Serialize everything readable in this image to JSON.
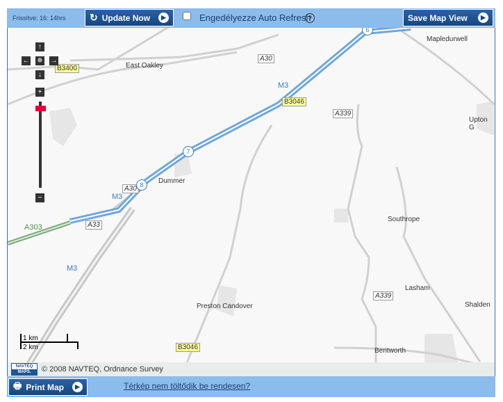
{
  "topbar": {
    "refreshed": "Frissítve: 16: 14hrs",
    "update_now": "Update Now",
    "auto_refresh_label": "Engedélyezze Auto Refresh",
    "auto_refresh_checked": false,
    "help": "?",
    "save_map_view": "Save Map View"
  },
  "map": {
    "places": [
      "East Oakley",
      "Mapledurwell",
      "Dummer",
      "Upton G",
      "Southrope",
      "Lasham",
      "Shalden",
      "Preston Candover",
      "Bentworth"
    ],
    "roads": {
      "a30_top": "A30",
      "a30_mid": "A30",
      "a33": "A33",
      "a339_1": "A339",
      "a339_2": "A339",
      "a303": "A303",
      "b3400": "B3400",
      "b3046_1": "B3046",
      "b3046_2": "B3046",
      "m3_1": "M3",
      "m3_2": "M3",
      "m3_3": "M3"
    },
    "junctions": [
      "6",
      "7",
      "8"
    ],
    "scale": {
      "km1": "1 km",
      "km2": "2 km"
    },
    "zoom_level_fraction": 1.0,
    "copyright": "© 2008 NAVTEQ, Ordnance Survey",
    "logo_top": "NAVTEQ",
    "logo_bottom": "MAPS."
  },
  "colors": {
    "motorway": "#6fa6dc",
    "a_road": "#c8c8c8",
    "primary_green": "#7fae7f",
    "bar": "#8bbcec",
    "button": "#1f5692",
    "zoom_marker": "#e0003a"
  },
  "bottombar": {
    "print_map": "Print Map",
    "help_link": "Térkép nem töltődik be rendesen?"
  }
}
